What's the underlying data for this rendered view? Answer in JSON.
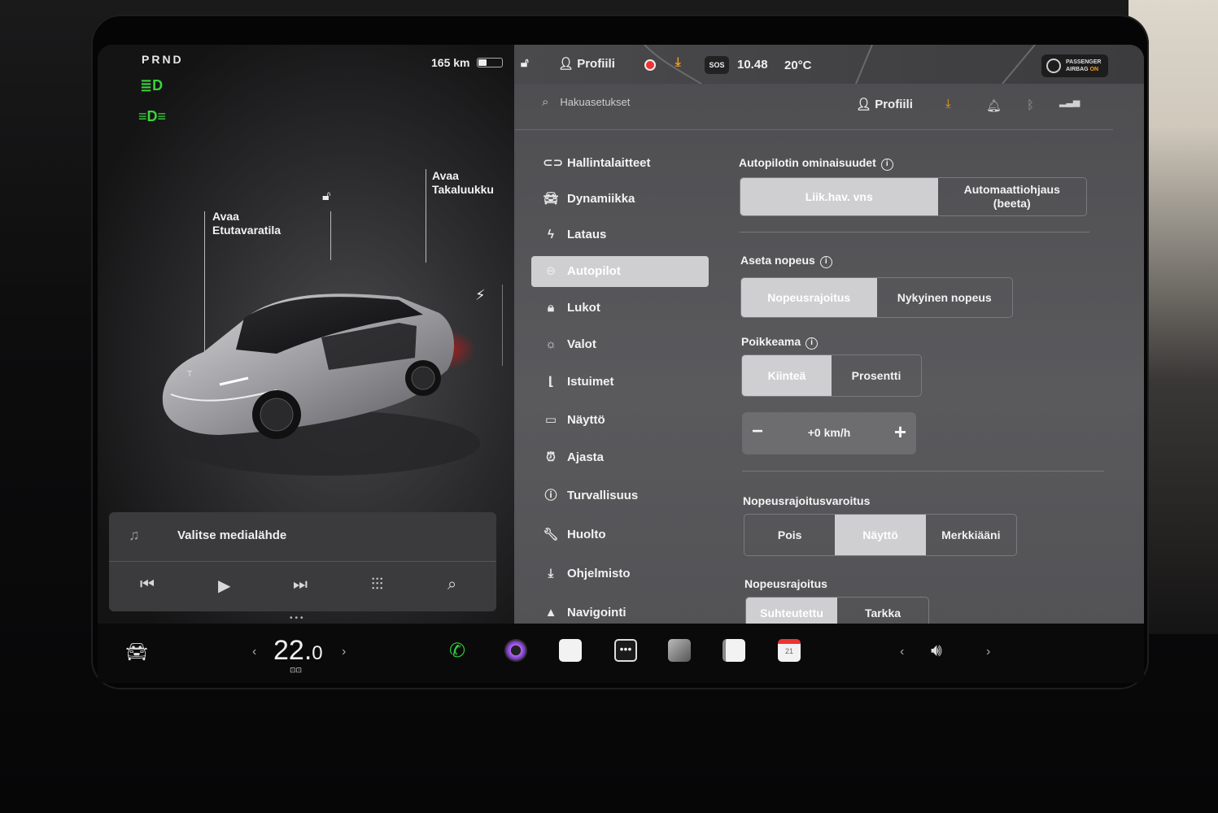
{
  "status": {
    "gear": "PRND",
    "range": "165 km",
    "profile": "Profiili",
    "time": "10.48",
    "temperature": "20°C",
    "sos": "SOS",
    "airbag_line1": "PASSENGER",
    "airbag_line2": "AIRBAG",
    "airbag_state": "ON"
  },
  "car_panel": {
    "frunk_label_1": "Avaa",
    "frunk_label_2": "Etutavaratila",
    "trunk_label_1": "Avaa",
    "trunk_label_2": "Takaluukku"
  },
  "media": {
    "title": "Valitse medialähde"
  },
  "settings": {
    "search_placeholder": "Hakuasetukset",
    "profile": "Profiili",
    "nav": [
      {
        "label": "Hallintalaitteet",
        "icon": "toggle-icon"
      },
      {
        "label": "Dynamiikka",
        "icon": "car-icon"
      },
      {
        "label": "Lataus",
        "icon": "bolt-icon"
      },
      {
        "label": "Autopilot",
        "icon": "steering-wheel-icon"
      },
      {
        "label": "Lukot",
        "icon": "lock-icon"
      },
      {
        "label": "Valot",
        "icon": "sun-icon"
      },
      {
        "label": "Istuimet",
        "icon": "seat-icon"
      },
      {
        "label": "Näyttö",
        "icon": "display-icon"
      },
      {
        "label": "Ajasta",
        "icon": "alarm-icon"
      },
      {
        "label": "Turvallisuus",
        "icon": "alert-icon"
      },
      {
        "label": "Huolto",
        "icon": "wrench-icon"
      },
      {
        "label": "Ohjelmisto",
        "icon": "download-icon"
      },
      {
        "label": "Navigointi",
        "icon": "navigation-icon"
      }
    ],
    "active_nav": "Autopilot",
    "autopilot_features": {
      "label": "Autopilotin ominaisuudet",
      "options": [
        "Liik.hav. vns",
        "Automaattiohjaus (beeta)"
      ],
      "selected": "Liik.hav. vns"
    },
    "set_speed": {
      "label": "Aseta nopeus",
      "options": [
        "Nopeusrajoitus",
        "Nykyinen nopeus"
      ],
      "selected": "Nopeusrajoitus"
    },
    "offset": {
      "label": "Poikkeama",
      "options": [
        "Kiinteä",
        "Prosentti"
      ],
      "selected": "Kiinteä",
      "value": "+0 km/h"
    },
    "speed_warning": {
      "label": "Nopeusrajoitusvaroitus",
      "options": [
        "Pois",
        "Näyttö",
        "Merkkiääni"
      ],
      "selected": "Näyttö"
    },
    "speed_limit": {
      "label": "Nopeusrajoitus",
      "options": [
        "Suhteutettu",
        "Tarkka"
      ],
      "selected": "Suhteutettu"
    }
  },
  "dock": {
    "temperature_whole": "22.",
    "temperature_decimal": "0",
    "calendar_day": "21"
  }
}
